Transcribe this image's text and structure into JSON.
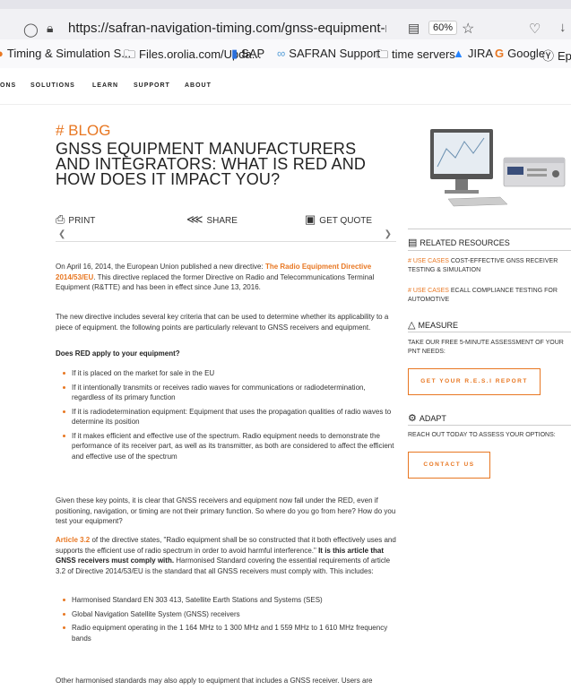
{
  "browser": {
    "url": "https://safran-navigation-timing.com/gnss-equipment-manufacturers-and",
    "zoom": "60%",
    "bookmarks": [
      "Timing & Simulation S...",
      "Files.orolia.com/Upda...",
      "SAP",
      "SAFRAN Support",
      "time servers",
      "JIRA",
      "Google",
      "Epoch"
    ]
  },
  "nav": {
    "items": [
      "ONS",
      "SOLUTIONS",
      "LEARN",
      "SUPPORT",
      "ABOUT"
    ]
  },
  "article": {
    "tag": "# BLOG",
    "title": "GNSS EQUIPMENT MANUFACTURERS AND INTEGRATORS: WHAT IS RED AND HOW DOES IT IMPACT YOU?",
    "toolbar": {
      "print": "PRINT",
      "share": "SHARE",
      "quote": "GET QUOTE"
    },
    "p1_a": "On April 16, 2014, the European Union published a new directive: ",
    "p1_link": "The Radio Equipment Directive 2014/53/EU",
    "p1_b": ". This directive replaced the former Directive on Radio and Telecommunications Terminal Equipment (R&TTE) and has been in effect since June 13, 2016.",
    "p2": "The new directive includes several key criteria that can be used to determine whether its applicability to a piece of equipment. the following points are particularly relevant to GNSS receivers and equipment.",
    "question": "Does RED apply to your equipment?",
    "criteria": [
      "If it is placed on the market for sale in the EU",
      "If it intentionally transmits or receives radio waves for communications or radiodetermination, regardless of its primary function",
      "If it is radiodetermination equipment: Equipment that uses the propagation qualities of radio waves to determine its position",
      "If it makes efficient and effective use of the spectrum. Radio equipment needs to demonstrate the performance of its receiver part, as well as its transmitter, as both are considered to affect the efficient and effective use of the spectrum"
    ],
    "p3": "Given these key points, it is clear that GNSS receivers and equipment now fall under the RED, even if positioning, navigation, or timing are not their primary function. So where do you go from here? How do you test your equipment?",
    "p4_link": "Article 3.2",
    "p4_a": " of the directive states, \"Radio equipment shall be so constructed that it both effectively uses and supports the efficient use of radio spectrum in order to avoid harmful interference.\" ",
    "p4_bold": "It is this article that GNSS receivers must comply with.",
    "p4_b": " Harmonised Standard covering the essential requirements of article 3.2 of Directive 2014/53/EU is the standard that all GNSS receivers must comply with. This includes:",
    "standards": [
      "Harmonised Standard EN 303 413, Satellite Earth Stations and Systems (SES)",
      "Global Navigation Satellite System (GNSS) receivers",
      "Radio equipment operating in the 1 164 MHz to 1 300 MHz and 1 559 MHz to 1 610 MHz frequency bands"
    ],
    "p5": "Other harmonised standards may also apply to equipment that includes a GNSS receiver. Users are"
  },
  "sidebar": {
    "related_title": "RELATED RESOURCES",
    "related": [
      {
        "tag": "# USE CASES",
        "text": " COST-EFFECTIVE GNSS RECEIVER TESTING & SIMULATION"
      },
      {
        "tag": "# USE CASES",
        "text": " ECALL COMPLIANCE TESTING FOR AUTOMOTIVE"
      }
    ],
    "measure_title": "MEASURE",
    "measure_text": "TAKE OUR FREE 5-MINUTE ASSESSMENT OF YOUR PNT NEEDS:",
    "measure_btn": "GET YOUR R.E.S.I REPORT",
    "adapt_title": "ADAPT",
    "adapt_text": "REACH OUT TODAY TO ASSESS YOUR OPTIONS:",
    "adapt_btn": "CONTACT US"
  },
  "colors": {
    "accent": "#e87722"
  }
}
